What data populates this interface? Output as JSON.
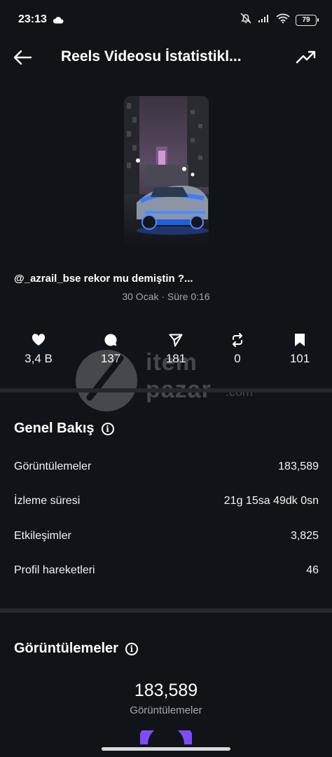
{
  "status_bar": {
    "time": "23:13",
    "battery": "79"
  },
  "header": {
    "title": "Reels Videosu İstatistikl..."
  },
  "reel": {
    "caption": "@_azrail_bse rekor mu demiştin ?...",
    "meta": "30 Ocak · Süre 0:16"
  },
  "metrics": [
    {
      "icon": "heart-icon",
      "value": "3,4 B"
    },
    {
      "icon": "comment-icon",
      "value": "137"
    },
    {
      "icon": "share-icon",
      "value": "181"
    },
    {
      "icon": "repost-icon",
      "value": "0"
    },
    {
      "icon": "bookmark-icon",
      "value": "101"
    }
  ],
  "watermark": {
    "line1": "item",
    "line2": "pazar",
    "suffix": ".com"
  },
  "overview": {
    "title": "Genel Bakış",
    "rows": [
      {
        "label": "Görüntülemeler",
        "value": "183,589"
      },
      {
        "label": "İzleme süresi",
        "value": "21g 15sa 49dk 0sn"
      },
      {
        "label": "Etkileşimler",
        "value": "3,825"
      },
      {
        "label": "Profil hareketleri",
        "value": "46"
      }
    ]
  },
  "views": {
    "title": "Görüntülemeler",
    "total": "183,589",
    "label": "Görüntülemeler"
  },
  "colors": {
    "background": "#101419",
    "divider": "#24282d",
    "gauge": "#7c4dff"
  }
}
